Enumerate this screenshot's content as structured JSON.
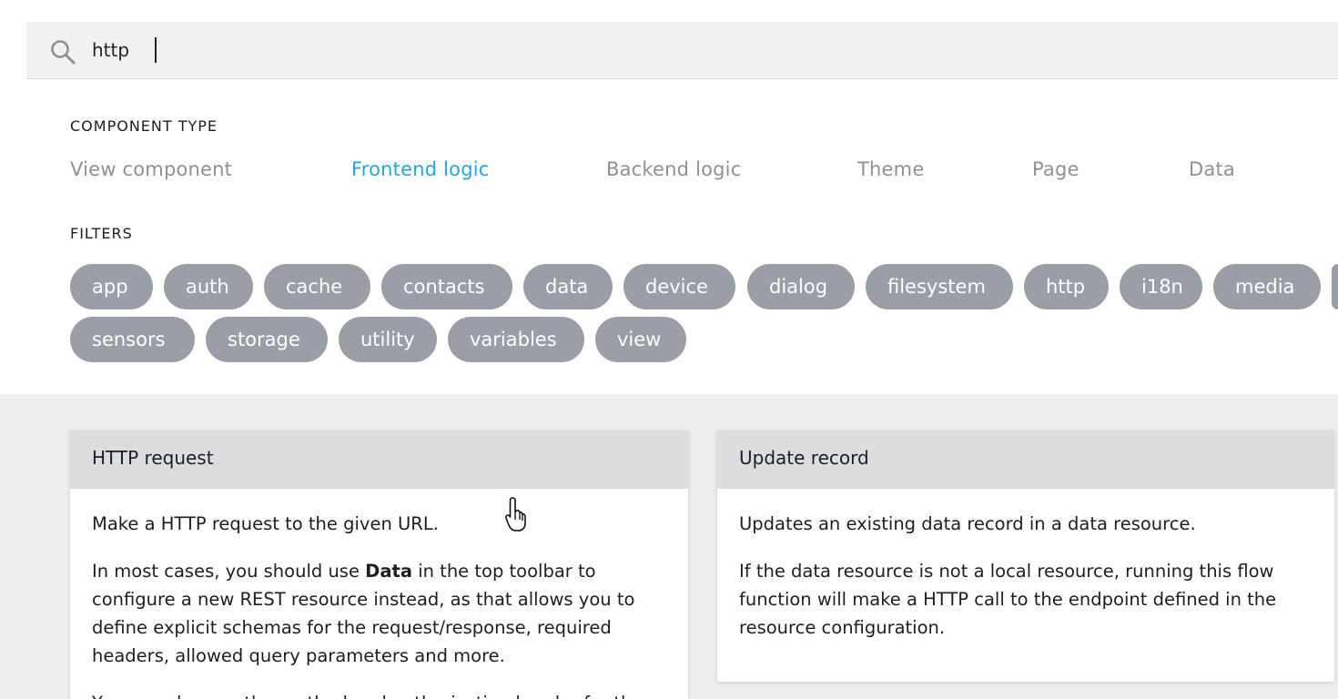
{
  "search": {
    "value": "http",
    "icon": "search-icon"
  },
  "component_type": {
    "label": "COMPONENT TYPE",
    "tabs": [
      {
        "label": "View component",
        "active": false
      },
      {
        "label": "Frontend logic",
        "active": true
      },
      {
        "label": "Backend logic",
        "active": false
      },
      {
        "label": "Theme",
        "active": false
      },
      {
        "label": "Page",
        "active": false
      },
      {
        "label": "Data",
        "active": false
      }
    ],
    "active_color": "#1ba8ea"
  },
  "filters": {
    "label": "FILTERS",
    "chips": [
      "app",
      "auth",
      "cache",
      "contacts",
      "data",
      "device",
      "dialog",
      "filesystem",
      "http",
      "i18n",
      "media",
      "sensors",
      "storage",
      "utility",
      "variables",
      "view"
    ]
  },
  "results": [
    {
      "title": "HTTP request",
      "description": "Make a HTTP request to the given URL.",
      "details_before": "In most cases, you should use ",
      "details_bold": "Data",
      "details_after": " in the top toolbar to configure a new REST resource instead, as that allows you to define explicit schemas for the request/response, required headers, allowed query parameters and more.",
      "more": "You can also use the method and authorization header for the"
    },
    {
      "title": "Update record",
      "description": "Updates an existing data record in a data resource.",
      "details": "If the data resource is not a local resource, running this flow function will make a HTTP call to the endpoint defined in the resource configuration."
    }
  ],
  "colors": {
    "chip_bg": "#9a9ea6",
    "results_bg": "#edeeef",
    "card_header_bg": "#dcdddf"
  }
}
